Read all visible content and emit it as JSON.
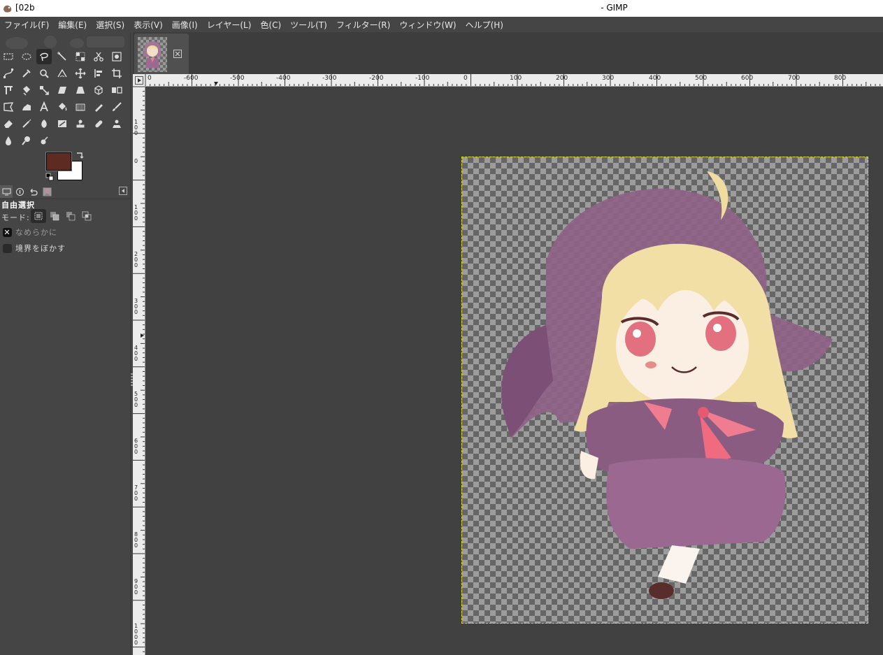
{
  "titlebar": {
    "doc_title": "[02b",
    "app_title": "- GIMP"
  },
  "menubar": {
    "items": [
      {
        "label": "ファイル(F)"
      },
      {
        "label": "編集(E)"
      },
      {
        "label": "選択(S)"
      },
      {
        "label": "表示(V)"
      },
      {
        "label": "画像(I)"
      },
      {
        "label": "レイヤー(L)"
      },
      {
        "label": "色(C)"
      },
      {
        "label": "ツール(T)"
      },
      {
        "label": "フィルター(R)"
      },
      {
        "label": "ウィンドウ(W)"
      },
      {
        "label": "ヘルプ(H)"
      }
    ]
  },
  "toolbox": {
    "active_tool": "free-select-tool",
    "foreground_color": "#5e2b22",
    "background_color": "#ffffff"
  },
  "tool_options": {
    "title": "自由選択",
    "mode_label": "モード:",
    "antialias": {
      "label": "なめらかに",
      "checked": true
    },
    "feather": {
      "label": "境界をぼかす",
      "checked": false
    }
  },
  "rulers": {
    "horizontal": [
      "0",
      "-600",
      "-500",
      "-400",
      "-300",
      "-200",
      "-100",
      "0",
      "100",
      "200",
      "300",
      "400",
      "500",
      "600",
      "700",
      "800"
    ],
    "vertical": [
      "1\n0\n0",
      "0",
      "1\n0\n0",
      "2\n0\n0",
      "3\n0\n0",
      "4\n0\n0",
      "5\n0\n0",
      "6\n0\n0",
      "7\n0\n0",
      "8\n0\n0",
      "9\n0\n0",
      "1\n0\n0\n0"
    ]
  },
  "colors": {
    "ui_bg": "#454545",
    "canvas_bg": "#414141",
    "selection_outline": "#e6e600"
  }
}
